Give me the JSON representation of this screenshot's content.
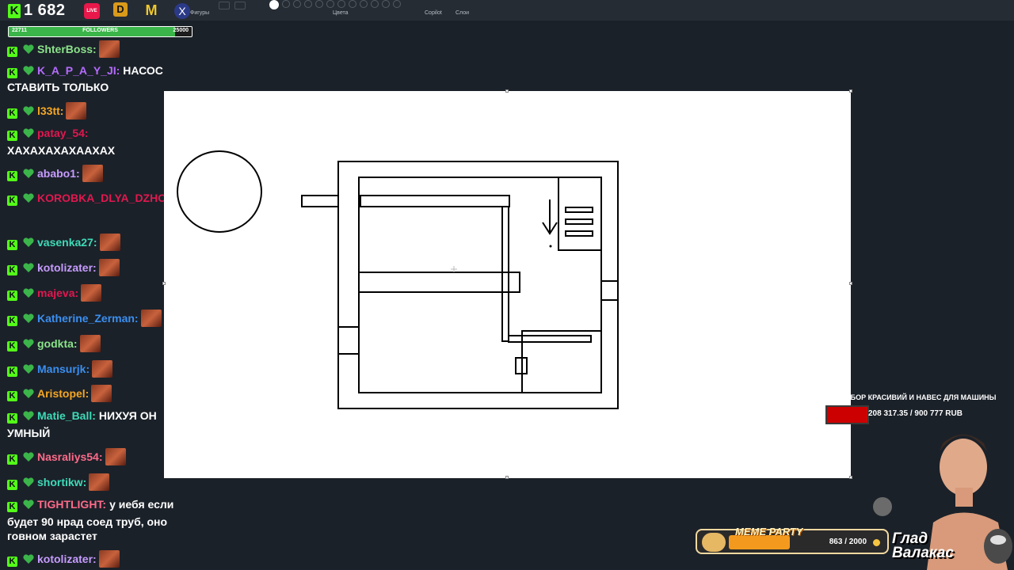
{
  "toolbar": {
    "labels": {
      "colors": "Цвета",
      "copilot": "Copilot",
      "layers": "Слои",
      "shapes": "Фигуры"
    }
  },
  "stream": {
    "viewer_count": "1 682",
    "live_badge": "LIVE",
    "d_badge": "D",
    "m_badge": "M",
    "x_badge": "X",
    "followers": {
      "current": "22711",
      "label": "FOLLOWERS",
      "target": "25000",
      "progress": 0.908
    }
  },
  "chat": [
    {
      "user": "ShterBoss:",
      "color": "#8be38a",
      "text": "",
      "emote": true,
      "cont": ""
    },
    {
      "user": "K_A_P_A_Y_JI:",
      "color": "#b56bff",
      "text": "НАСОС",
      "emote": false,
      "cont": "СТАВИТЬ ТОЛЬКО"
    },
    {
      "user": "l33tt:",
      "color": "#f5a623",
      "text": "",
      "emote": true,
      "cont": ""
    },
    {
      "user": "patay_54:",
      "color": "#e0184f",
      "text": "",
      "emote": false,
      "cont": "ХАХАХАХАХААХАХ"
    },
    {
      "user": "ababo1:",
      "color": "#c69cff",
      "text": "",
      "emote": true,
      "cont": ""
    },
    {
      "user": "KOROBKA_DLYA_DZHOSTIKA:",
      "color": "#e0184f",
      "text": "",
      "emote": true,
      "cont": ""
    },
    {
      "user": "vasenka27:",
      "color": "#3ddbb8",
      "text": "",
      "emote": true,
      "cont": ""
    },
    {
      "user": "kotolizater:",
      "color": "#c69cff",
      "text": "",
      "emote": true,
      "cont": ""
    },
    {
      "user": "majeva:",
      "color": "#e0184f",
      "text": "",
      "emote": true,
      "cont": ""
    },
    {
      "user": "Katherine_Zerman:",
      "color": "#3a8ff0",
      "text": "",
      "emote": true,
      "cont": ""
    },
    {
      "user": "godkta:",
      "color": "#8be38a",
      "text": "",
      "emote": true,
      "cont": ""
    },
    {
      "user": "Mansurjk:",
      "color": "#3a8ff0",
      "text": "",
      "emote": true,
      "cont": ""
    },
    {
      "user": "Aristopel:",
      "color": "#f5a623",
      "text": "",
      "emote": true,
      "cont": ""
    },
    {
      "user": "Matie_Ball:",
      "color": "#3ddbb8",
      "text": "НИХУЯ ОН",
      "emote": false,
      "cont": "УМНЫЙ"
    },
    {
      "user": "Nasraliys54:",
      "color": "#ff6b8a",
      "text": "",
      "emote": true,
      "cont": ""
    },
    {
      "user": "shortikw:",
      "color": "#3ddbb8",
      "text": "",
      "emote": true,
      "cont": ""
    },
    {
      "user": "TIGHTLIGHT:",
      "color": "#ff6b8a",
      "text": "у иебя если",
      "emote": false,
      "cont": "будет 90 нрад соед труб, оно"
    },
    {
      "user": "",
      "color": "#ffffff",
      "text": "",
      "emote": false,
      "cont": "говном зарастет"
    },
    {
      "user": "kotolizater:",
      "color": "#c69cff",
      "text": "",
      "emote": true,
      "cont": ""
    }
  ],
  "donation_goal": {
    "title": "НА ЗАБОР КРАСИВИЙ И НАВЕС ДЛЯ МАШИНЫ",
    "amount": "208 317.35 / 900 777 RUB",
    "progress": 0.231
  },
  "meme_party": {
    "label": "MEME PARTY",
    "count": "863 / 2000",
    "progress": 0.43
  },
  "streamer": {
    "name_line1": "Глад",
    "name_line2": "Валакас"
  },
  "colors": {
    "kick_green": "#53fc18",
    "canvas_bg": "#ffffff",
    "goal_red": "#cc0000",
    "meme_orange": "#f39a1e"
  }
}
